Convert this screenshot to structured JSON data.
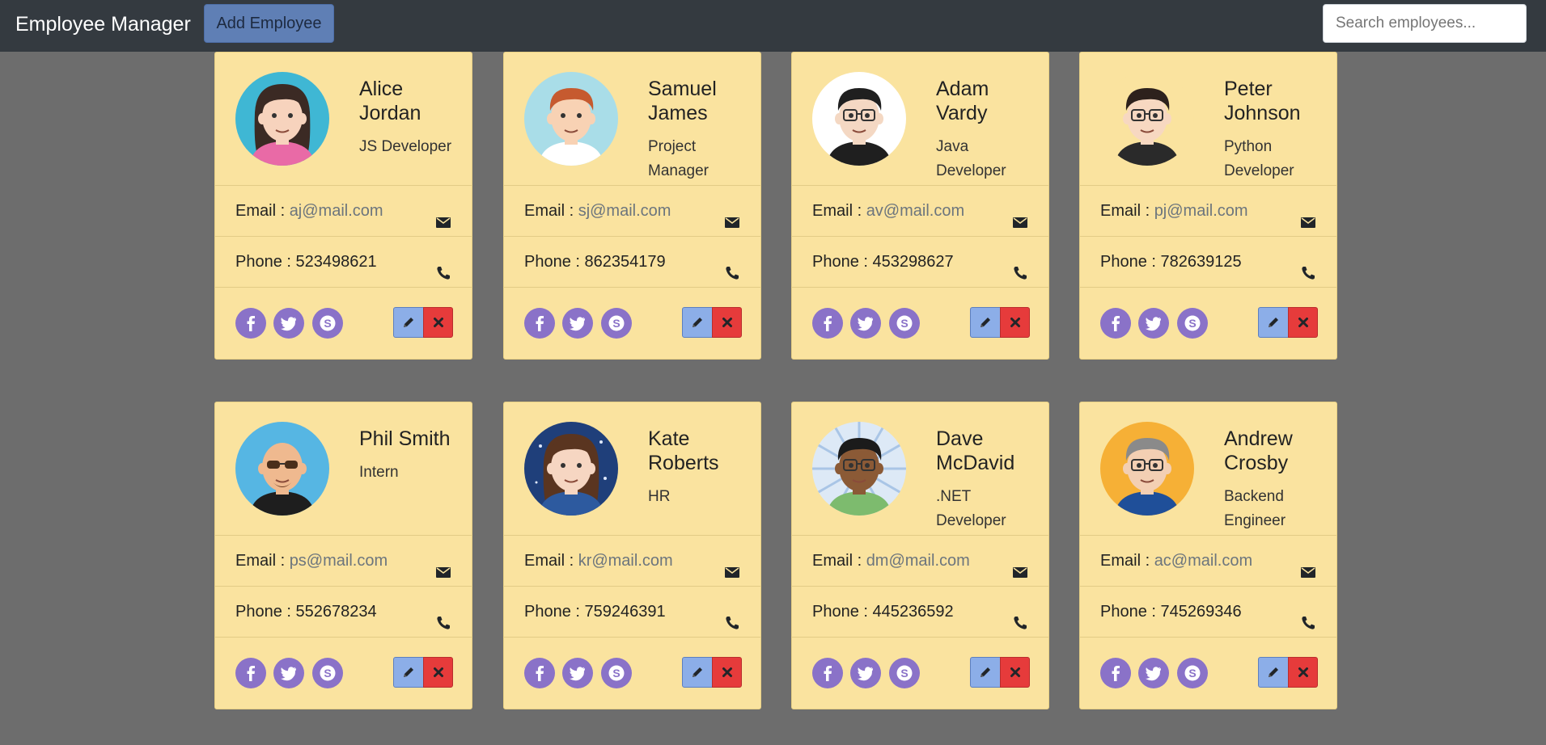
{
  "navbar": {
    "brand": "Employee Manager",
    "add_button": "Add Employee",
    "search_placeholder": "Search employees..."
  },
  "employees": [
    {
      "name_line1": "Alice",
      "name_line2": "Jordan",
      "role_line1": "JS Developer",
      "role_line2": "",
      "email_label": "Email : ",
      "email": "aj@mail.com",
      "phone_label": "Phone : ",
      "phone": "523498621",
      "avatar": "woman-dark-hair-pink-shirt"
    },
    {
      "name_line1": "Samuel",
      "name_line2": "James",
      "role_line1": "Project",
      "role_line2": "Manager",
      "email_label": "Email : ",
      "email": "sj@mail.com",
      "phone_label": "Phone : ",
      "phone": "862354179",
      "avatar": "man-red-hair-blue-shirt"
    },
    {
      "name_line1": "Adam",
      "name_line2": "Vardy",
      "role_line1": "Java",
      "role_line2": "Developer",
      "email_label": "Email : ",
      "email": "av@mail.com",
      "phone_label": "Phone : ",
      "phone": "453298627",
      "avatar": "man-black-hair-glasses"
    },
    {
      "name_line1": "Peter",
      "name_line2": "Johnson",
      "role_line1": "Python",
      "role_line2": "Developer",
      "email_label": "Email : ",
      "email": "pj@mail.com",
      "phone_label": "Phone : ",
      "phone": "782639125",
      "avatar": "man-glasses-dark-shirt"
    },
    {
      "name_line1": "Phil Smith",
      "name_line2": "",
      "role_line1": "Intern",
      "role_line2": "",
      "email_label": "Email : ",
      "email": "ps@mail.com",
      "phone_label": "Phone : ",
      "phone": "552678234",
      "avatar": "man-sunglasses-beard"
    },
    {
      "name_line1": "Kate",
      "name_line2": "Roberts",
      "role_line1": "HR",
      "role_line2": "",
      "email_label": "Email : ",
      "email": "kr@mail.com",
      "phone_label": "Phone : ",
      "phone": "759246391",
      "avatar": "woman-brown-hair-night"
    },
    {
      "name_line1": "Dave",
      "name_line2": "McDavid",
      "role_line1": ".NET",
      "role_line2": "Developer",
      "email_label": "Email : ",
      "email": "dm@mail.com",
      "phone_label": "Phone : ",
      "phone": "445236592",
      "avatar": "man-dark-skin-glasses"
    },
    {
      "name_line1": "Andrew",
      "name_line2": "Crosby",
      "role_line1": "Backend",
      "role_line2": "Engineer",
      "email_label": "Email : ",
      "email": "ac@mail.com",
      "phone_label": "Phone : ",
      "phone": "745269346",
      "avatar": "man-gray-hair-glasses"
    }
  ],
  "colors": {
    "navbar": "#343a40",
    "page_background": "#6d6d6d",
    "card_background": "#fae39f",
    "social_button": "#8a72c8",
    "edit_button": "#8caee8",
    "delete_button": "#e63b3b",
    "add_button": "#5f7fb5"
  },
  "icons": {
    "email": "envelope-icon",
    "phone": "phone-icon",
    "social": [
      "facebook-icon",
      "twitter-icon",
      "skype-icon"
    ],
    "edit": "pencil-icon",
    "delete": "close-icon"
  }
}
